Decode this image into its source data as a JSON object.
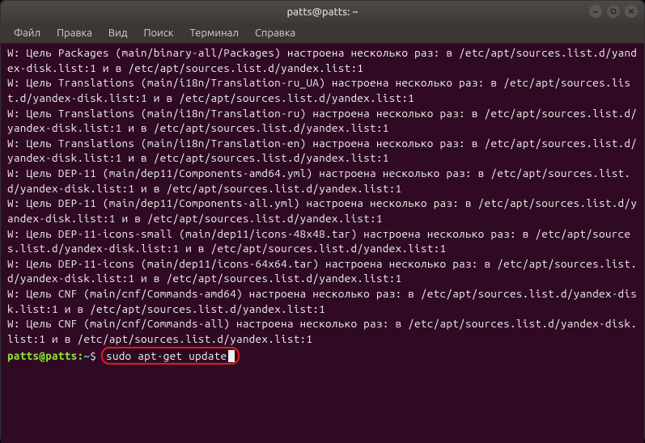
{
  "titlebar": {
    "title": "patts@patts: ~"
  },
  "menubar": {
    "items": [
      "Файл",
      "Правка",
      "Вид",
      "Поиск",
      "Терминал",
      "Справка"
    ]
  },
  "terminal": {
    "lines": [
      "W: Цель Packages (main/binary-all/Packages) настроена несколько раз: в /etc/apt/sources.list.d/yandex-disk.list:1 и в /etc/apt/sources.list.d/yandex.list:1",
      "W: Цель Translations (main/i18n/Translation-ru_UA) настроена несколько раз: в /etc/apt/sources.list.d/yandex-disk.list:1 и в /etc/apt/sources.list.d/yandex.list:1",
      "W: Цель Translations (main/i18n/Translation-ru) настроена несколько раз: в /etc/apt/sources.list.d/yandex-disk.list:1 и в /etc/apt/sources.list.d/yandex.list:1",
      "W: Цель Translations (main/i18n/Translation-en) настроена несколько раз: в /etc/apt/sources.list.d/yandex-disk.list:1 и в /etc/apt/sources.list.d/yandex.list:1",
      "W: Цель DEP-11 (main/dep11/Components-amd64.yml) настроена несколько раз: в /etc/apt/sources.list.d/yandex-disk.list:1 и в /etc/apt/sources.list.d/yandex.list:1",
      "W: Цель DEP-11 (main/dep11/Components-all.yml) настроена несколько раз: в /etc/apt/sources.list.d/yandex-disk.list:1 и в /etc/apt/sources.list.d/yandex.list:1",
      "W: Цель DEP-11-icons-small (main/dep11/icons-48x48.tar) настроена несколько раз: в /etc/apt/sources.list.d/yandex-disk.list:1 и в /etc/apt/sources.list.d/yandex.list:1",
      "W: Цель DEP-11-icons (main/dep11/icons-64x64.tar) настроена несколько раз: в /etc/apt/sources.list.d/yandex-disk.list:1 и в /etc/apt/sources.list.d/yandex.list:1",
      "W: Цель CNF (main/cnf/Commands-amd64) настроена несколько раз: в /etc/apt/sources.list.d/yandex-disk.list:1 и в /etc/apt/sources.list.d/yandex.list:1",
      "W: Цель CNF (main/cnf/Commands-all) настроена несколько раз: в /etc/apt/sources.list.d/yandex-disk.list:1 и в /etc/apt/sources.list.d/yandex.list:1"
    ],
    "prompt": {
      "user_host": "patts@patts",
      "path": "~",
      "separator": ":",
      "dollar": "$",
      "command": "sudo apt-get update"
    }
  }
}
